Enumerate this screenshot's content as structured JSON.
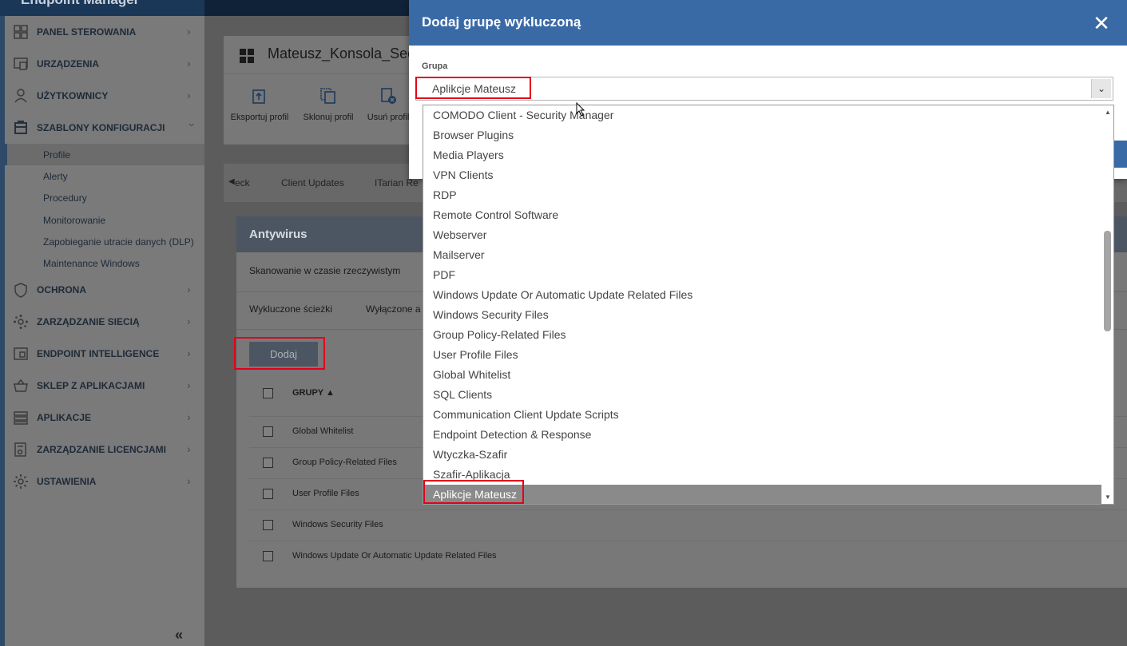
{
  "app": {
    "brand": "Endpoint Manager"
  },
  "sidebar": {
    "items": [
      {
        "label": "PANEL STEROWANIA",
        "icon": "dashboard-icon"
      },
      {
        "label": "URZĄDZENIA",
        "icon": "devices-icon"
      },
      {
        "label": "UŻYTKOWNICY",
        "icon": "user-icon"
      },
      {
        "label": "SZABLONY KONFIGURACJI",
        "icon": "templates-icon",
        "expanded": true
      },
      {
        "label": "OCHRONA",
        "icon": "shield-icon"
      },
      {
        "label": "ZARZĄDZANIE SIECIĄ",
        "icon": "network-icon"
      },
      {
        "label": "ENDPOINT INTELLIGENCE",
        "icon": "intelligence-icon"
      },
      {
        "label": "SKLEP Z APLIKACJAMI",
        "icon": "basket-icon"
      },
      {
        "label": "APLIKACJE",
        "icon": "apps-icon"
      },
      {
        "label": "ZARZĄDZANIE LICENCJAMI",
        "icon": "license-icon"
      },
      {
        "label": "USTAWIENIA",
        "icon": "gear-icon"
      }
    ],
    "subitems": [
      {
        "label": "Profile",
        "active": true
      },
      {
        "label": "Alerty"
      },
      {
        "label": "Procedury"
      },
      {
        "label": "Monitorowanie"
      },
      {
        "label": "Zapobieganie utracie danych (DLP)"
      },
      {
        "label": "Maintenance Windows"
      }
    ],
    "collapse_label": "«"
  },
  "profile": {
    "title": "Mateusz_Konsola_Sec",
    "toolbar": [
      {
        "label": "Eksportuj profil",
        "icon": "export-icon"
      },
      {
        "label": "Sklonuj profil",
        "icon": "clone-icon"
      },
      {
        "label": "Usuń profil",
        "icon": "delete-icon"
      }
    ],
    "tabs": {
      "prev_label": "eck",
      "items": [
        "Client Updates",
        "ITarian Re"
      ]
    }
  },
  "panel": {
    "title": "Antywirus",
    "realtime": "Skanowanie w czasie rzeczywistym",
    "sub_tabs": [
      "Wykluczone ścieżki",
      "Wyłączone a"
    ],
    "add_button": "Dodaj",
    "column_header": "GRUPY",
    "rows": [
      "Global Whitelist",
      "Group Policy-Related Files",
      "User Profile Files",
      "Windows Security Files",
      "Windows Update Or Automatic Update Related Files"
    ]
  },
  "modal": {
    "title": "Dodaj grupę wykluczoną",
    "close_label": "✕",
    "field_label": "Grupa",
    "selected_value": "Aplikcje Mateusz",
    "options": [
      "COMODO Client - Security Manager",
      "Browser Plugins",
      "Media Players",
      "VPN Clients",
      "RDP",
      "Remote Control Software",
      "Webserver",
      "Mailserver",
      "PDF",
      "Windows Update Or Automatic Update Related Files",
      "Windows Security Files",
      "Group Policy-Related Files",
      "User Profile Files",
      "Global Whitelist",
      "SQL Clients",
      "Communication Client Update Scripts",
      "Endpoint Detection & Response",
      "Wtyczka-Szafir",
      "Szafir-Aplikacja",
      "Aplikcje Mateusz"
    ],
    "selected_index": 19
  },
  "colors": {
    "accent": "#3a6aa6",
    "sidebar_dark": "#1a3757",
    "highlight": "#e3001b",
    "selected_option": "#8a8a8a"
  }
}
